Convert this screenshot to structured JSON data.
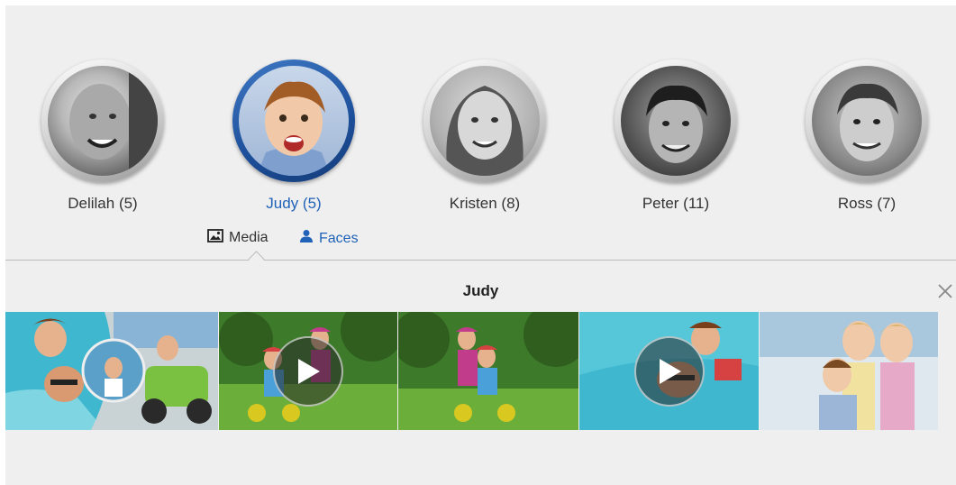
{
  "people": [
    {
      "name": "Delilah (5)",
      "selected": false
    },
    {
      "name": "Judy (5)",
      "selected": true
    },
    {
      "name": "Kristen (8)",
      "selected": false
    },
    {
      "name": "Peter (11)",
      "selected": false
    },
    {
      "name": "Ross (7)",
      "selected": false
    }
  ],
  "subtabs": {
    "media_label": "Media",
    "faces_label": "Faces"
  },
  "strip": {
    "title": "Judy",
    "items": [
      {
        "type": "collage"
      },
      {
        "type": "video"
      },
      {
        "type": "photo"
      },
      {
        "type": "video"
      },
      {
        "type": "photo"
      }
    ]
  },
  "colors": {
    "accent": "#1f62b8",
    "background": "#efefef"
  }
}
